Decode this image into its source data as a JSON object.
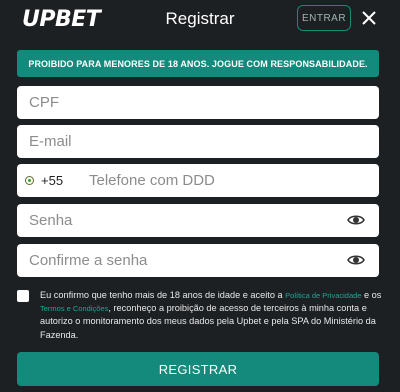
{
  "header": {
    "logo": "UPBET",
    "title": "Registrar",
    "enter_label": "ENTRAR"
  },
  "banner": "PROIBIDO PARA MENORES DE 18 ANOS. JOGUE COM RESPONSABILIDADE.",
  "form": {
    "cpf": {
      "placeholder": "CPF",
      "value": ""
    },
    "email": {
      "placeholder": "E-mail",
      "value": ""
    },
    "phone": {
      "dial_code": "+55",
      "placeholder": "Telefone com DDD",
      "value": ""
    },
    "password": {
      "placeholder": "Senha",
      "value": ""
    },
    "confirm_password": {
      "placeholder": "Confirme a senha",
      "value": ""
    }
  },
  "terms": {
    "text_1": "Eu confirmo que tenho mais de 18 anos de idade e aceito a ",
    "link_privacy": "Política de Privacidade",
    "text_2": " e os ",
    "link_terms": "Termos e Condições",
    "text_3": ", reconheço a proibição de acesso de terceiros à minha conta e autorizo o monitoramento dos meus dados pela Upbet e pela SPA do Ministério da Fazenda.",
    "checked": false
  },
  "register_label": "REGISTRAR",
  "colors": {
    "background": "#1d2023",
    "accent": "#138a7c",
    "link": "#1fa595"
  },
  "icons": {
    "close": "close-icon",
    "eye": "eye-icon",
    "country_flag": "brazil-flag-icon"
  }
}
